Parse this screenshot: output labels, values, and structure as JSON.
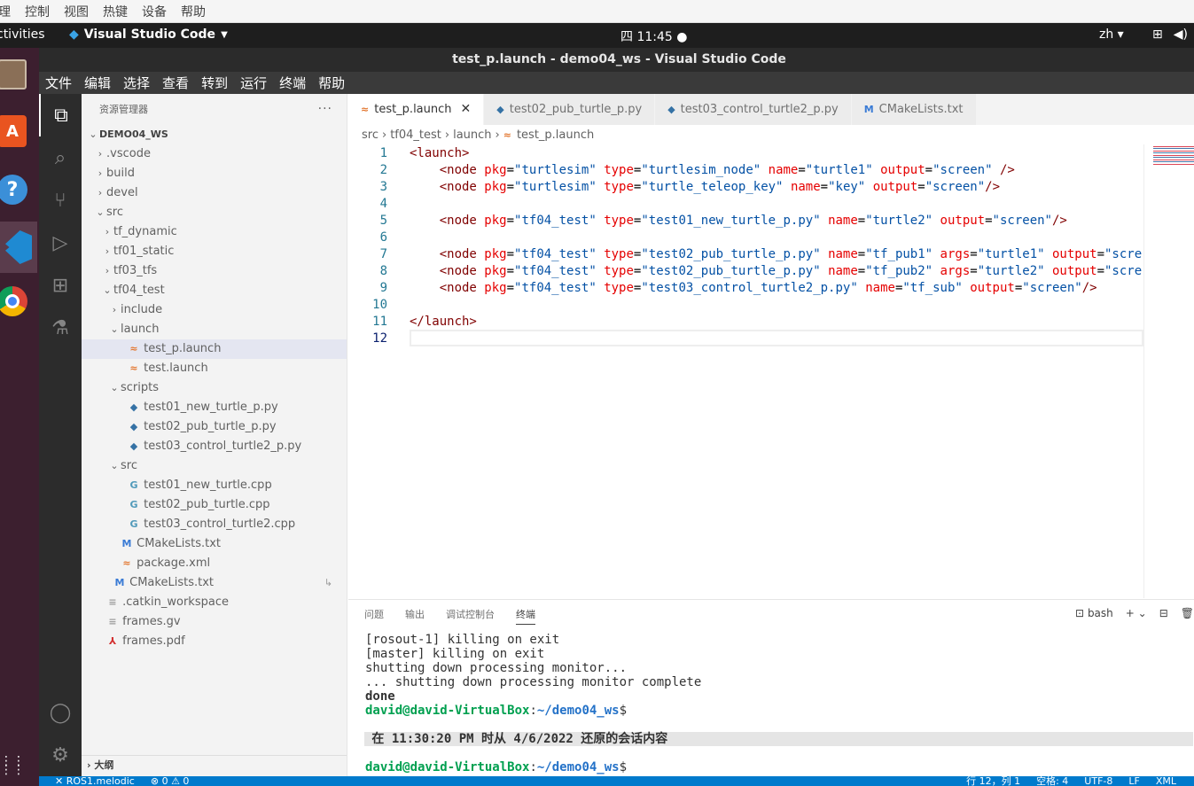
{
  "vbox_menu": [
    "理",
    "控制",
    "视图",
    "热键",
    "设备",
    "帮助"
  ],
  "topbar": {
    "activities": "ctivities",
    "app": "Visual Studio Code",
    "clock": "四 11:45",
    "lang": "zh"
  },
  "window_title": "test_p.launch - demo04_ws - Visual Studio Code",
  "menu": [
    "文件",
    "编辑",
    "选择",
    "查看",
    "转到",
    "运行",
    "终端",
    "帮助"
  ],
  "sidebar": {
    "header": "资源管理器",
    "outline": "大纲",
    "rows": [
      {
        "label": "DEMO04_WS",
        "depth": 0,
        "twisty": "v",
        "icon": "",
        "ws": true
      },
      {
        "label": ".vscode",
        "depth": 1,
        "twisty": ">",
        "icon": ""
      },
      {
        "label": "build",
        "depth": 1,
        "twisty": ">",
        "icon": ""
      },
      {
        "label": "devel",
        "depth": 1,
        "twisty": ">",
        "icon": ""
      },
      {
        "label": "src",
        "depth": 1,
        "twisty": "v",
        "icon": ""
      },
      {
        "label": "tf_dynamic",
        "depth": 2,
        "twisty": ">",
        "icon": ""
      },
      {
        "label": "tf01_static",
        "depth": 2,
        "twisty": ">",
        "icon": ""
      },
      {
        "label": "tf03_tfs",
        "depth": 2,
        "twisty": ">",
        "icon": ""
      },
      {
        "label": "tf04_test",
        "depth": 2,
        "twisty": "v",
        "icon": ""
      },
      {
        "label": "include",
        "depth": 3,
        "twisty": ">",
        "icon": ""
      },
      {
        "label": "launch",
        "depth": 3,
        "twisty": "v",
        "icon": ""
      },
      {
        "label": "test_p.launch",
        "depth": 4,
        "twisty": "",
        "icon": "rss",
        "sel": true
      },
      {
        "label": "test.launch",
        "depth": 4,
        "twisty": "",
        "icon": "rss"
      },
      {
        "label": "scripts",
        "depth": 3,
        "twisty": "v",
        "icon": ""
      },
      {
        "label": "test01_new_turtle_p.py",
        "depth": 4,
        "twisty": "",
        "icon": "py"
      },
      {
        "label": "test02_pub_turtle_p.py",
        "depth": 4,
        "twisty": "",
        "icon": "py"
      },
      {
        "label": "test03_control_turtle2_p.py",
        "depth": 4,
        "twisty": "",
        "icon": "py"
      },
      {
        "label": "src",
        "depth": 3,
        "twisty": "v",
        "icon": ""
      },
      {
        "label": "test01_new_turtle.cpp",
        "depth": 4,
        "twisty": "",
        "icon": "cpp"
      },
      {
        "label": "test02_pub_turtle.cpp",
        "depth": 4,
        "twisty": "",
        "icon": "cpp"
      },
      {
        "label": "test03_control_turtle2.cpp",
        "depth": 4,
        "twisty": "",
        "icon": "cpp"
      },
      {
        "label": "CMakeLists.txt",
        "depth": 3,
        "twisty": "",
        "icon": "cmake"
      },
      {
        "label": "package.xml",
        "depth": 3,
        "twisty": "",
        "icon": "rss"
      },
      {
        "label": "CMakeLists.txt",
        "depth": 2,
        "twisty": "",
        "icon": "cmake",
        "mark": "↳"
      },
      {
        "label": ".catkin_workspace",
        "depth": 1,
        "twisty": "",
        "icon": "txt"
      },
      {
        "label": "frames.gv",
        "depth": 1,
        "twisty": "",
        "icon": "txt"
      },
      {
        "label": "frames.pdf",
        "depth": 1,
        "twisty": "",
        "icon": "pdf"
      }
    ]
  },
  "tabs": [
    {
      "label": "test_p.launch",
      "icon": "rss",
      "active": true
    },
    {
      "label": "test02_pub_turtle_p.py",
      "icon": "py"
    },
    {
      "label": "test03_control_turtle2_p.py",
      "icon": "py"
    },
    {
      "label": "CMakeLists.txt",
      "icon": "cmake"
    }
  ],
  "breadcrumb": [
    "src",
    "tf04_test",
    "launch",
    "test_p.launch"
  ],
  "code_lines": [
    [
      [
        "tg",
        "<launch>"
      ]
    ],
    [
      [
        "pl",
        "    "
      ],
      [
        "tg",
        "<node "
      ],
      [
        "at",
        "pkg"
      ],
      [
        "pl",
        "="
      ],
      [
        "vl",
        "\"turtlesim\""
      ],
      [
        "pl",
        " "
      ],
      [
        "at",
        "type"
      ],
      [
        "pl",
        "="
      ],
      [
        "vl",
        "\"turtlesim_node\""
      ],
      [
        "pl",
        " "
      ],
      [
        "at",
        "name"
      ],
      [
        "pl",
        "="
      ],
      [
        "vl",
        "\"turtle1\""
      ],
      [
        "pl",
        " "
      ],
      [
        "at",
        "output"
      ],
      [
        "pl",
        "="
      ],
      [
        "vl",
        "\"screen\""
      ],
      [
        "pl",
        " "
      ],
      [
        "tg",
        "/>"
      ]
    ],
    [
      [
        "pl",
        "    "
      ],
      [
        "tg",
        "<node "
      ],
      [
        "at",
        "pkg"
      ],
      [
        "pl",
        "="
      ],
      [
        "vl",
        "\"turtlesim\""
      ],
      [
        "pl",
        " "
      ],
      [
        "at",
        "type"
      ],
      [
        "pl",
        "="
      ],
      [
        "vl",
        "\"turtle_teleop_key\""
      ],
      [
        "pl",
        " "
      ],
      [
        "at",
        "name"
      ],
      [
        "pl",
        "="
      ],
      [
        "vl",
        "\"key\""
      ],
      [
        "pl",
        " "
      ],
      [
        "at",
        "output"
      ],
      [
        "pl",
        "="
      ],
      [
        "vl",
        "\"screen\""
      ],
      [
        "tg",
        "/>"
      ]
    ],
    [],
    [
      [
        "pl",
        "    "
      ],
      [
        "tg",
        "<node "
      ],
      [
        "at",
        "pkg"
      ],
      [
        "pl",
        "="
      ],
      [
        "vl",
        "\"tf04_test\""
      ],
      [
        "pl",
        " "
      ],
      [
        "at",
        "type"
      ],
      [
        "pl",
        "="
      ],
      [
        "vl",
        "\"test01_new_turtle_p.py\""
      ],
      [
        "pl",
        " "
      ],
      [
        "at",
        "name"
      ],
      [
        "pl",
        "="
      ],
      [
        "vl",
        "\"turtle2\""
      ],
      [
        "pl",
        " "
      ],
      [
        "at",
        "output"
      ],
      [
        "pl",
        "="
      ],
      [
        "vl",
        "\"screen\""
      ],
      [
        "tg",
        "/>"
      ]
    ],
    [],
    [
      [
        "pl",
        "    "
      ],
      [
        "tg",
        "<node "
      ],
      [
        "at",
        "pkg"
      ],
      [
        "pl",
        "="
      ],
      [
        "vl",
        "\"tf04_test\""
      ],
      [
        "pl",
        " "
      ],
      [
        "at",
        "type"
      ],
      [
        "pl",
        "="
      ],
      [
        "vl",
        "\"test02_pub_turtle_p.py\""
      ],
      [
        "pl",
        " "
      ],
      [
        "at",
        "name"
      ],
      [
        "pl",
        "="
      ],
      [
        "vl",
        "\"tf_pub1\""
      ],
      [
        "pl",
        " "
      ],
      [
        "at",
        "args"
      ],
      [
        "pl",
        "="
      ],
      [
        "vl",
        "\"turtle1\""
      ],
      [
        "pl",
        " "
      ],
      [
        "at",
        "output"
      ],
      [
        "pl",
        "="
      ],
      [
        "vl",
        "\"scre"
      ]
    ],
    [
      [
        "pl",
        "    "
      ],
      [
        "tg",
        "<node "
      ],
      [
        "at",
        "pkg"
      ],
      [
        "pl",
        "="
      ],
      [
        "vl",
        "\"tf04_test\""
      ],
      [
        "pl",
        " "
      ],
      [
        "at",
        "type"
      ],
      [
        "pl",
        "="
      ],
      [
        "vl",
        "\"test02_pub_turtle_p.py\""
      ],
      [
        "pl",
        " "
      ],
      [
        "at",
        "name"
      ],
      [
        "pl",
        "="
      ],
      [
        "vl",
        "\"tf_pub2\""
      ],
      [
        "pl",
        " "
      ],
      [
        "at",
        "args"
      ],
      [
        "pl",
        "="
      ],
      [
        "vl",
        "\"turtle2\""
      ],
      [
        "pl",
        " "
      ],
      [
        "at",
        "output"
      ],
      [
        "pl",
        "="
      ],
      [
        "vl",
        "\"scre"
      ]
    ],
    [
      [
        "pl",
        "    "
      ],
      [
        "tg",
        "<node "
      ],
      [
        "at",
        "pkg"
      ],
      [
        "pl",
        "="
      ],
      [
        "vl",
        "\"tf04_test\""
      ],
      [
        "pl",
        " "
      ],
      [
        "at",
        "type"
      ],
      [
        "pl",
        "="
      ],
      [
        "vl",
        "\"test03_control_turtle2_p.py\""
      ],
      [
        "pl",
        " "
      ],
      [
        "at",
        "name"
      ],
      [
        "pl",
        "="
      ],
      [
        "vl",
        "\"tf_sub\""
      ],
      [
        "pl",
        " "
      ],
      [
        "at",
        "output"
      ],
      [
        "pl",
        "="
      ],
      [
        "vl",
        "\"screen\""
      ],
      [
        "tg",
        "/>"
      ]
    ],
    [],
    [
      [
        "tg",
        "</launch>"
      ]
    ],
    []
  ],
  "panel": {
    "tabs": [
      "问题",
      "输出",
      "调试控制台",
      "终端"
    ],
    "active": "终端",
    "shell": "bash",
    "lines": [
      "[rosout-1] killing on exit",
      "[master] killing on exit",
      "shutting down processing monitor...",
      "... shutting down processing monitor complete",
      "done"
    ],
    "prompt_user": "david@david-VirtualBox",
    "prompt_path": "~/demo04_ws",
    "prompt_sym": "$",
    "restore": " 在 11:30:20 PM 时从 4/6/2022 还原的会话内容"
  },
  "status": {
    "left": [
      "✕ ROS1.melodic",
      "⊗ 0 ⚠ 0"
    ],
    "right": [
      "行 12，列 1",
      "空格: 4",
      "UTF-8",
      "LF",
      "XML"
    ]
  }
}
